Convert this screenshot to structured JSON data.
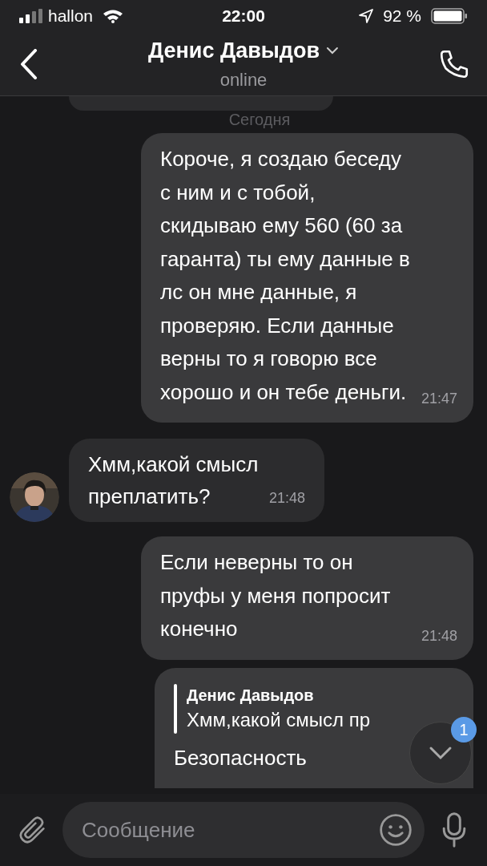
{
  "status_bar": {
    "carrier": "hallon",
    "time": "22:00",
    "battery": "92 %"
  },
  "header": {
    "name": "Денис Давыдов",
    "status": "online"
  },
  "date_label": "Сегодня",
  "messages": [
    {
      "kind": "outgoing",
      "text": "Короче, я создаю беседу с ним и с тобой, скидываю ему 560 (60 за гаранта)  ты ему данные в лс он мне данные, я проверяю. Если данные верны то я говорю все хорошо и он тебе деньги.",
      "time": "21:47"
    },
    {
      "kind": "incoming",
      "text": "Хмм,какой смысл преплатить?",
      "time": "21:48"
    },
    {
      "kind": "outgoing",
      "text": "Если неверны то он пруфы у меня попросит конечно",
      "time": "21:48"
    },
    {
      "kind": "reply",
      "quote_author": "Денис Давыдов",
      "quote_text": "Хмм,какой смысл пр",
      "text": "Безопасность"
    }
  ],
  "scroll_badge": "1",
  "composer": {
    "placeholder": "Сообщение"
  }
}
